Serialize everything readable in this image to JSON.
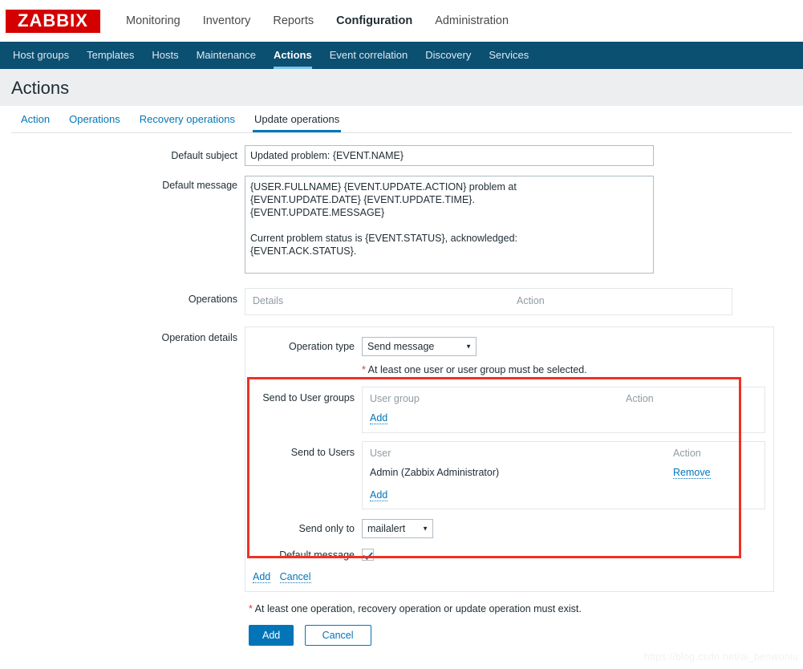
{
  "header": {
    "logo_text": "ZABBIX",
    "menu": [
      {
        "label": "Monitoring",
        "selected": false
      },
      {
        "label": "Inventory",
        "selected": false
      },
      {
        "label": "Reports",
        "selected": false
      },
      {
        "label": "Configuration",
        "selected": true
      },
      {
        "label": "Administration",
        "selected": false
      }
    ]
  },
  "navbar": {
    "items": [
      {
        "label": "Host groups",
        "selected": false
      },
      {
        "label": "Templates",
        "selected": false
      },
      {
        "label": "Hosts",
        "selected": false
      },
      {
        "label": "Maintenance",
        "selected": false
      },
      {
        "label": "Actions",
        "selected": true
      },
      {
        "label": "Event correlation",
        "selected": false
      },
      {
        "label": "Discovery",
        "selected": false
      },
      {
        "label": "Services",
        "selected": false
      }
    ]
  },
  "page": {
    "title": "Actions"
  },
  "form_tabs": [
    {
      "label": "Action",
      "selected": false
    },
    {
      "label": "Operations",
      "selected": false
    },
    {
      "label": "Recovery operations",
      "selected": false
    },
    {
      "label": "Update operations",
      "selected": true
    }
  ],
  "form": {
    "default_subject": {
      "label": "Default subject",
      "value": "Updated problem: {EVENT.NAME}",
      "placeholder": ""
    },
    "default_message": {
      "label": "Default message",
      "value": "{USER.FULLNAME} {EVENT.UPDATE.ACTION} problem at\n{EVENT.UPDATE.DATE} {EVENT.UPDATE.TIME}.\n{EVENT.UPDATE.MESSAGE}\n\nCurrent problem status is {EVENT.STATUS}, acknowledged:\n{EVENT.ACK.STATUS}.",
      "placeholder": ""
    },
    "operations": {
      "label": "Operations",
      "columns": [
        "Details",
        "Action"
      ],
      "rows": []
    },
    "operation_details": {
      "label": "Operation details",
      "operation_type": {
        "label": "Operation type",
        "value": "Send message",
        "options": [
          "Send message"
        ]
      },
      "hint": {
        "star": "*",
        "text": "At least one user or user group must be selected."
      },
      "send_to_user_groups": {
        "label": "Send to User groups",
        "columns": [
          "User group",
          "Action"
        ],
        "rows": [],
        "add_label": "Add"
      },
      "send_to_users": {
        "label": "Send to Users",
        "columns": [
          "User",
          "Action"
        ],
        "rows": [
          {
            "user": "Admin (Zabbix Administrator)",
            "action": "Remove"
          }
        ],
        "add_label": "Add"
      },
      "send_only_to": {
        "label": "Send only to",
        "value": "mailalert",
        "options": [
          "mailalert"
        ]
      },
      "default_message_checkbox": {
        "label": "Default message",
        "checked": true
      },
      "links": {
        "add": "Add",
        "cancel": "Cancel"
      }
    },
    "footnote": {
      "star": "*",
      "text": "At least one operation, recovery operation or update operation must exist."
    },
    "buttons": {
      "submit": "Add",
      "cancel": "Cancel"
    }
  },
  "watermark": "https://blog.csdn.net/ai_benwoniu",
  "colors": {
    "brand_red": "#d40000",
    "navbar_bg": "#0b4f71",
    "accent_blue": "#0275b8",
    "highlight_red": "#ee3124",
    "title_strip": "#eceef0"
  }
}
